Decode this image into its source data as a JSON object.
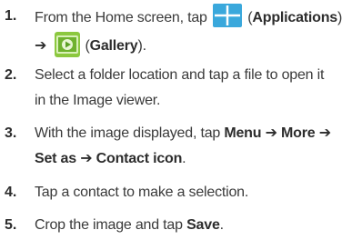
{
  "steps": [
    {
      "number": "1.",
      "line1_text1": "From the Home screen, tap",
      "line1_text2": "(",
      "apps_label": "Applications",
      "line1_text3": ")",
      "arrow": "➔",
      "gallery_open": "(",
      "gallery_label": "Gallery",
      "gallery_close": ")."
    },
    {
      "number": "2.",
      "line1": "Select a folder location and tap a file to open it",
      "line2": "in the Image viewer."
    },
    {
      "number": "3.",
      "text1": "With the image displayed, tap",
      "menu": "Menu",
      "arrow1": "➔",
      "more": "More",
      "arrow2": "➔",
      "setas": "Set as",
      "arrow3": "➔",
      "contact_icon": "Contact icon",
      "period": "."
    },
    {
      "number": "4.",
      "text": "Tap a contact to make a selection."
    },
    {
      "number": "5.",
      "text1": "Crop the image and tap",
      "save": "Save",
      "period": "."
    }
  ],
  "icons": {
    "applications": "applications-grid-icon",
    "gallery": "gallery-icon"
  },
  "colors": {
    "apps_icon": "#3aa8dc",
    "gallery_green": "#7cc23a"
  }
}
